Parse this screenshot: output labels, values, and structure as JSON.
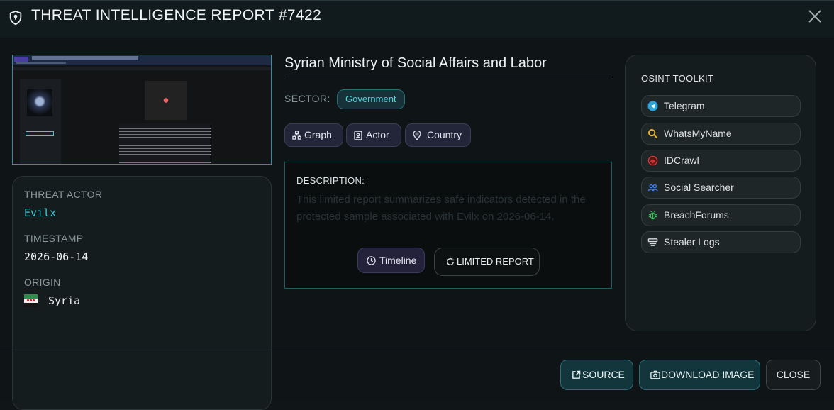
{
  "header": {
    "title": "THREAT INTELLIGENCE REPORT #7422",
    "icon": "shield-icon",
    "close_icon": "close-icon"
  },
  "details": {
    "threat_actor_label": "THREAT ACTOR",
    "threat_actor": "Evilx",
    "timestamp_label": "TIMESTAMP",
    "timestamp": "2026-06-14",
    "origin_label": "ORIGIN",
    "origin": "Syria"
  },
  "entity": {
    "title": "Syrian Ministry of Social Affairs and Labor",
    "sector_label": "SECTOR:",
    "sector": "Government",
    "chips": [
      {
        "label": "Graph",
        "icon": "graph-icon"
      },
      {
        "label": "Actor",
        "icon": "id-card-icon"
      },
      {
        "label": "Country",
        "icon": "location-pin-icon"
      }
    ]
  },
  "description": {
    "label": "DESCRIPTION:",
    "text": "This limited report summarizes safe indicators detected in the protected sample associated with Evilx on 2026-06-14.",
    "timeline_label": "Timeline",
    "limited_label": "LIMITED REPORT"
  },
  "osint": {
    "title": "OSINT TOOLKIT",
    "tools": [
      {
        "label": "Telegram",
        "icon": "telegram-icon"
      },
      {
        "label": "WhatsMyName",
        "icon": "search-icon"
      },
      {
        "label": "IDCrawl",
        "icon": "fingerprint-icon"
      },
      {
        "label": "Social Searcher",
        "icon": "users-icon"
      },
      {
        "label": "BreachForums",
        "icon": "bug-icon"
      },
      {
        "label": "Stealer Logs",
        "icon": "server-icon"
      }
    ]
  },
  "footer": {
    "source_label": "SOURCE",
    "download_label": "DOWNLOAD IMAGE",
    "close_label": "CLOSE"
  },
  "colors": {
    "accent": "#3ec9d6",
    "background": "#0f1517",
    "chip": "#232638"
  }
}
